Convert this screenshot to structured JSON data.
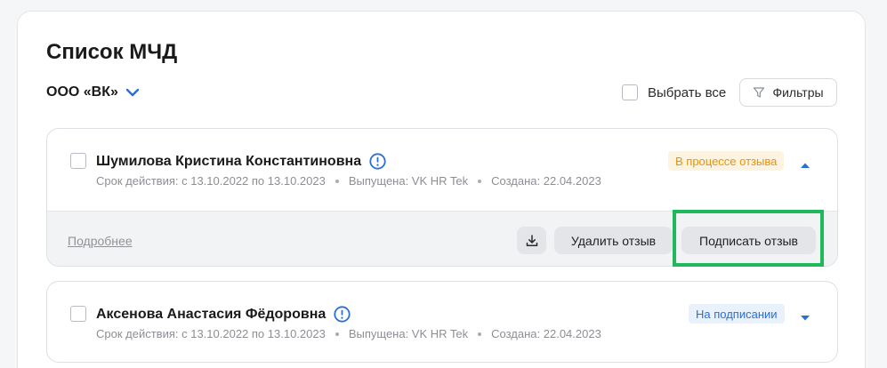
{
  "page": {
    "title": "Список МЧД",
    "organization": "ООО «ВК»",
    "select_all_label": "Выбрать все",
    "filters_label": "Фильтры"
  },
  "cards": [
    {
      "name": "Шумилова Кристина Константиновна",
      "validity": "Срок действия: с 13.10.2022 по 13.10.2023",
      "issued_by": "Выпущена: VK HR Tek",
      "created": "Создана: 22.04.2023",
      "status": "В процессе отзыва",
      "status_color": "#e6930b",
      "expanded": true,
      "details_link": "Подробнее",
      "delete_label": "Удалить отзыв",
      "sign_label": "Подписать отзыв"
    },
    {
      "name": "Аксенова Анастасия Фёдоровна",
      "validity": "Срок действия: с 13.10.2022 по 13.10.2023",
      "issued_by": "Выпущена: VK HR Tek",
      "created": "Создана: 22.04.2023",
      "status": "На подписании",
      "status_color": "#2a6fd6",
      "expanded": false
    }
  ],
  "icons": {
    "org_dropdown": "chevron-down-icon",
    "filters": "filter-icon",
    "info": "info-icon",
    "download": "download-icon",
    "collapse": "caret-up-icon",
    "expand": "caret-down-icon"
  },
  "colors": {
    "accent": "#2a6fd6",
    "highlight": "#1fb85b"
  }
}
